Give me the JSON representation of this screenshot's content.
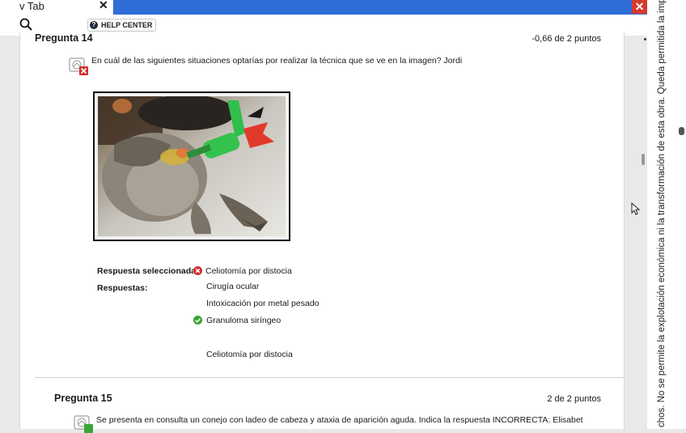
{
  "browser": {
    "tab_label": "v Tab",
    "tab_close": "✕",
    "window_close": "✕",
    "help_center_label": "HELP CENTER",
    "help_center_glyph": "?"
  },
  "questions": [
    {
      "title": "Pregunta 14",
      "points": "-0,66 de 2 puntos",
      "text": "En cuál de las siguientes situaciones optarías por realizar la técnica que se ve en la imagen?   Jordi",
      "selected_label": "Respuesta seleccionada:",
      "selected_answer": "Celiotomía por distocia",
      "answers_label": "Respuestas:",
      "answers": [
        "Cirugía ocular",
        "Intoxicación por metal pesado",
        "Granuloma siríngeo",
        "Celiotomía por distocia"
      ],
      "correct_answer_index": 2,
      "status": "incorrect"
    },
    {
      "title": "Pregunta 15",
      "points": "2 de 2 puntos",
      "text": "Se presenta en consulta un conejo con ladeo de cabeza y ataxia de aparición aguda. Indica la respuesta INCORRECTA:  Elisabet",
      "status": "correct"
    }
  ],
  "side_notice": "chos. No se permite la explotación económica ni la transformación de esta obra. Queda permitida la impresión",
  "colors": {
    "accent_blue": "#2e6dd6",
    "incorrect_red": "#d32f2f",
    "correct_green": "#3aa636",
    "close_red": "#d53a2e"
  },
  "icons": [
    "search-icon",
    "help-circle-icon",
    "question-status-icon",
    "x-mark-icon",
    "check-icon",
    "cursor-icon"
  ]
}
